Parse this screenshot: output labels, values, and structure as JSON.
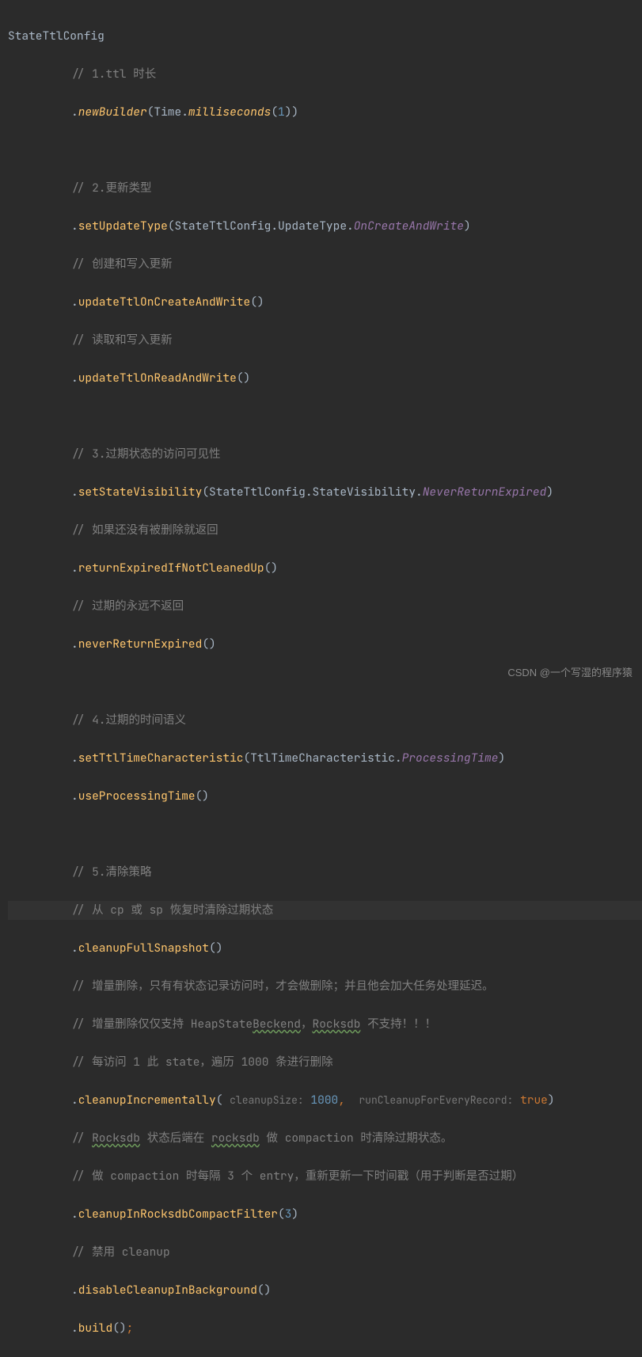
{
  "code": {
    "className": "StateTtlConfig",
    "c1": "// 1.ttl 时长",
    "newBuilder": "newBuilder",
    "time": "Time",
    "milliseconds": "milliseconds",
    "num1": "1",
    "c2": "// 2.更新类型",
    "setUpdateType": "setUpdateType",
    "updateType": "UpdateType",
    "onCreateAndWrite": "OnCreateAndWrite",
    "c2a": "// 创建和写入更新",
    "updateTtlOnCreateAndWrite": "updateTtlOnCreateAndWrite",
    "c2b": "// 读取和写入更新",
    "updateTtlOnReadAndWrite": "updateTtlOnReadAndWrite",
    "c3": "// 3.过期状态的访问可见性",
    "setStateVisibility": "setStateVisibility",
    "stateVisibility": "StateVisibility",
    "neverReturnExpiredConst": "NeverReturnExpired",
    "c3a": "// 如果还没有被删除就返回",
    "returnExpiredIfNotCleanedUp": "returnExpiredIfNotCleanedUp",
    "c3b": "// 过期的永远不返回",
    "neverReturnExpired": "neverReturnExpired",
    "c4": "// 4.过期的时间语义",
    "setTtlTimeCharacteristic": "setTtlTimeCharacteristic",
    "ttlTimeCharacteristic": "TtlTimeCharacteristic",
    "processingTime": "ProcessingTime",
    "useProcessingTime": "useProcessingTime",
    "c5": "// 5.清除策略",
    "c5a": "// 从 cp 或 sp 恢复时清除过期状态",
    "cleanupFullSnapshot": "cleanupFullSnapshot",
    "c5b": "// 增量删除，只有有状态记录访问时，才会做删除；并且他会加大任务处理延迟。",
    "c5c_p1": "// 增量删除仅仅支持 HeapState",
    "c5c_typo1": "Beckend",
    "c5c_p2": "，",
    "c5c_typo2": "Rocksdb",
    "c5c_p3": " 不支持！！！",
    "c5d": "// 每访问 1 此 state，遍历 1000 条进行删除",
    "cleanupIncrementally": "cleanupIncrementally",
    "hint_cleanupSize": "cleanupSize:",
    "num1000": "1000",
    "hint_runCleanup": "runCleanupForEveryRecord:",
    "trueLit": "true",
    "c5e_p1": "// ",
    "c5e_typo1": "Rocksdb",
    "c5e_p2": " 状态后端在 ",
    "c5e_typo2": "rocksdb",
    "c5e_p3": " 做 compaction 时清除过期状态。",
    "c5f": "// 做 compaction 时每隔 3 个 entry，重新更新一下时间戳（用于判断是否过期）",
    "cleanupInRocksdbCompactFilter": "cleanupInRocksdbCompactFilter",
    "num3": "3",
    "c5g": "// 禁用 cleanup",
    "disableCleanupInBackground": "disableCleanupInBackground",
    "build": "build",
    "semicolon": ";"
  },
  "watermark": "CSDN @一个写湿的程序猿"
}
